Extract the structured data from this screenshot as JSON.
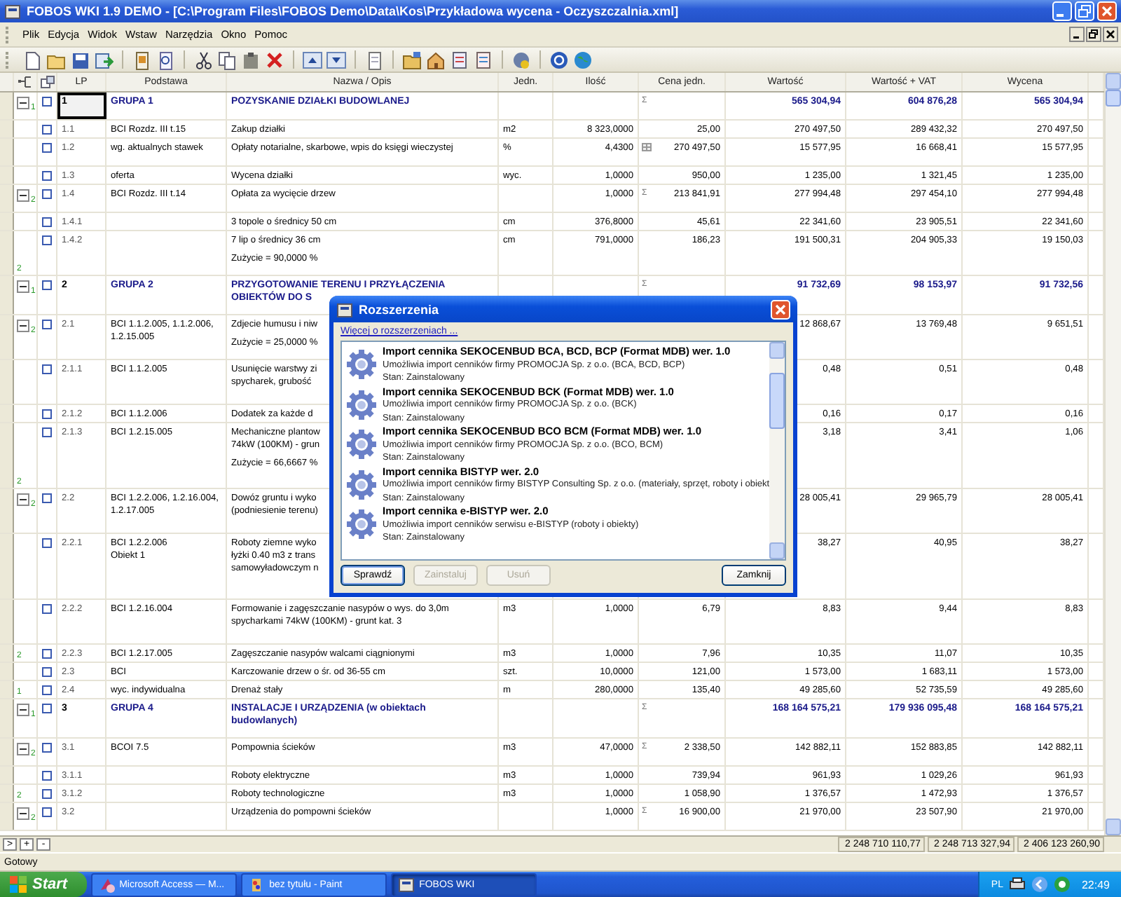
{
  "window": {
    "title": "FOBOS WKI  1.9 DEMO - [C:\\Program Files\\FOBOS Demo\\Data\\Kos\\Przykładowa wycena - Oczyszczalnia.xml]"
  },
  "menu": [
    "Plik",
    "Edycja",
    "Widok",
    "Wstaw",
    "Narzędzia",
    "Okno",
    "Pomoc"
  ],
  "table": {
    "columns": [
      "LP",
      "Podstawa",
      "Nazwa / Opis",
      "Jedn.",
      "Ilość",
      "Cena jedn.",
      "Wartość",
      "Wartość + VAT",
      "Wycena"
    ],
    "rows": [
      {
        "lp": "1",
        "podstawa": "GRUPA 1",
        "nazwa": "POZYSKANIE DZIAŁKI BUDOWLANEJ",
        "cena_mark": {
          "kind": "sigma",
          "text": "Σ"
        },
        "wartosc": "565 304,94",
        "wartosc_vat": "604 876,28",
        "wycena": "565 304,94",
        "group": true,
        "selected": true,
        "tree": {
          "kind": "expand",
          "label": "1"
        }
      },
      {
        "lp": "1.1",
        "podstawa": "BCI Rozdz. III t.15",
        "nazwa": "Zakup działki",
        "jedn": "m2",
        "ilosc": "8 323,0000",
        "cena": "25,00",
        "wartosc": "270 497,50",
        "wartosc_vat": "289 432,32",
        "wycena": "270 497,50",
        "group": false,
        "selected": false
      },
      {
        "lp": "1.2",
        "podstawa": "wg. aktualnych stawek",
        "nazwa": "Opłaty notarialne, skarbowe, wpis do księgi wieczystej",
        "jedn": "%",
        "ilosc": "4,4300",
        "cena_mark": {
          "kind": "table"
        },
        "cena": "270 497,50",
        "wartosc": "15 577,95",
        "wartosc_vat": "16 668,41",
        "wycena": "15 577,95",
        "group": false,
        "selected": false
      },
      {
        "lp": "1.3",
        "podstawa": "oferta",
        "nazwa": "Wycena działki",
        "jedn": "wyc.",
        "ilosc": "1,0000",
        "cena": "950,00",
        "wartosc": "1 235,00",
        "wartosc_vat": "1 321,45",
        "wycena": "1 235,00",
        "group": false,
        "selected": false
      },
      {
        "lp": "1.4",
        "podstawa": "BCI Rozdz. III t.14",
        "nazwa": "Opłata za wycięcie drzew",
        "ilosc": "1,0000",
        "cena_mark": {
          "kind": "sigma",
          "text": "Σ"
        },
        "cena": "213 841,91",
        "wartosc": "277 994,48",
        "wartosc_vat": "297 454,10",
        "wycena": "277 994,48",
        "group": false,
        "selected": false,
        "tree": {
          "kind": "expand",
          "label": "2"
        }
      },
      {
        "lp": "1.4.1",
        "nazwa": "3 topole o średnicy 50 cm",
        "jedn": "cm",
        "ilosc": "376,8000",
        "cena": "45,61",
        "wartosc": "22 341,60",
        "wartosc_vat": "23 905,51",
        "wycena": "22 341,60",
        "group": false,
        "selected": false
      },
      {
        "lp": "1.4.2",
        "nazwa": "7 lip o średnicy 36 cm",
        "note": "Zużycie = 90,0000 %",
        "jedn": "cm",
        "ilosc": "791,0000",
        "cena": "186,23",
        "wartosc": "191 500,31",
        "wartosc_vat": "204 905,33",
        "wycena": "19 150,03",
        "group": false,
        "selected": false,
        "tree": {
          "kind": "end",
          "label": "2"
        }
      },
      {
        "lp": "2",
        "podstawa": "GRUPA 2",
        "nazwa": "PRZYGOTOWANIE TERENU I PRZYŁĄCZENIA\nOBIEKTÓW DO S",
        "cena_mark": {
          "kind": "sigma",
          "text": "Σ"
        },
        "wartosc": "91 732,69",
        "wartosc_vat": "98 153,97",
        "wycena": "91 732,56",
        "group": true,
        "selected": false,
        "tree": {
          "kind": "expand",
          "label": "1"
        }
      },
      {
        "lp": "2.1",
        "podstawa": "BCI 1.1.2.005,  1.1.2.006,\n1.2.15.005",
        "nazwa": "Zdjecie humusu i niw",
        "note": "Zużycie = 25,0000 %",
        "wartosc": "12 868,67",
        "wartosc_vat": "13 769,48",
        "wycena": "9 651,51",
        "group": false,
        "selected": false,
        "tree": {
          "kind": "expand",
          "label": "2"
        }
      },
      {
        "lp": "2.1.1",
        "podstawa": "BCI 1.1.2.005",
        "nazwa": "Usunięcie warstwy zi\nspycharek, grubość",
        "wartosc": "0,48",
        "wartosc_vat": "0,51",
        "wycena": "0,48",
        "group": false,
        "selected": false
      },
      {
        "lp": "2.1.2",
        "podstawa": "BCI 1.1.2.006",
        "nazwa": "Dodatek za każde d",
        "wartosc": "0,16",
        "wartosc_vat": "0,17",
        "wycena": "0,16",
        "group": false,
        "selected": false
      },
      {
        "lp": "2.1.3",
        "podstawa": "BCI 1.2.15.005",
        "nazwa": "Mechaniczne plantow\n74kW (100KM) - grun",
        "note": "Zużycie = 66,6667 %",
        "wartosc": "3,18",
        "wartosc_vat": "3,41",
        "wycena": "1,06",
        "group": false,
        "selected": false,
        "tree": {
          "kind": "end",
          "label": "2"
        }
      },
      {
        "lp": "2.2",
        "podstawa": "BCI 1.2.2.006,  1.2.16.004,\n1.2.17.005",
        "nazwa": "Dowóz gruntu i wyko\n(podniesienie terenu)",
        "wartosc": "28 005,41",
        "wartosc_vat": "29 965,79",
        "wycena": "28 005,41",
        "group": false,
        "selected": false,
        "tree": {
          "kind": "expand",
          "label": "2"
        }
      },
      {
        "lp": "2.2.1",
        "podstawa": "BCI 1.2.2.006\nObiekt 1",
        "nazwa": "Roboty ziemne wyko\nłyżki 0.40 m3  z trans\nsamowyładowczym n",
        "wartosc": "38,27",
        "wartosc_vat": "40,95",
        "wycena": "38,27",
        "group": false,
        "selected": false
      },
      {
        "lp": "2.2.2",
        "podstawa": "BCI 1.2.16.004",
        "nazwa": "Formowanie i zagęszczanie nasypów o wys. do 3,0m\nspycharkami 74kW (100KM) - grunt kat. 3",
        "jedn": "m3",
        "ilosc": "1,0000",
        "cena": "6,79",
        "wartosc": "8,83",
        "wartosc_vat": "9,44",
        "wycena": "8,83",
        "group": false,
        "selected": false
      },
      {
        "lp": "2.2.3",
        "podstawa": "BCI 1.2.17.005",
        "nazwa": "Zagęszczanie nasypów walcami ciągnionymi",
        "jedn": "m3",
        "ilosc": "1,0000",
        "cena": "7,96",
        "wartosc": "10,35",
        "wartosc_vat": "11,07",
        "wycena": "10,35",
        "group": false,
        "selected": false,
        "tree": {
          "kind": "end",
          "label": "2"
        }
      },
      {
        "lp": "2.3",
        "podstawa": "BCI",
        "nazwa": "Karczowanie drzew o śr. od 36-55 cm",
        "jedn": "szt.",
        "ilosc": "10,0000",
        "cena": "121,00",
        "wartosc": "1 573,00",
        "wartosc_vat": "1 683,11",
        "wycena": "1 573,00",
        "group": false,
        "selected": false
      },
      {
        "lp": "2.4",
        "podstawa": "wyc. indywidualna",
        "nazwa": "Drenaż stały",
        "jedn": "m",
        "ilosc": "280,0000",
        "cena": "135,40",
        "wartosc": "49 285,60",
        "wartosc_vat": "52 735,59",
        "wycena": "49 285,60",
        "group": false,
        "selected": false,
        "tree": {
          "kind": "end",
          "label": "1"
        }
      },
      {
        "lp": "3",
        "podstawa": "GRUPA 4",
        "nazwa": "INSTALACJE I URZĄDZENIA (w obiektach\nbudowlanych)",
        "cena_mark": {
          "kind": "sigma",
          "text": "Σ"
        },
        "wartosc": "168 164 575,21",
        "wartosc_vat": "179 936 095,48",
        "wycena": "168 164 575,21",
        "group": true,
        "selected": false,
        "tree": {
          "kind": "expand",
          "label": "1"
        }
      },
      {
        "lp": "3.1",
        "podstawa": "BCOI 7.5",
        "nazwa": "Pompownia ścieków",
        "jedn": "m3",
        "ilosc": "47,0000",
        "cena_mark": {
          "kind": "sigma",
          "text": "Σ"
        },
        "cena": "2 338,50",
        "wartosc": "142 882,11",
        "wartosc_vat": "152 883,85",
        "wycena": "142 882,11",
        "group": false,
        "selected": false,
        "tree": {
          "kind": "expand",
          "label": "2"
        }
      },
      {
        "lp": "3.1.1",
        "nazwa": "Roboty elektryczne",
        "jedn": "m3",
        "ilosc": "1,0000",
        "cena": "739,94",
        "wartosc": "961,93",
        "wartosc_vat": "1 029,26",
        "wycena": "961,93",
        "group": false,
        "selected": false
      },
      {
        "lp": "3.1.2",
        "nazwa": "Roboty technologiczne",
        "jedn": "m3",
        "ilosc": "1,0000",
        "cena": "1 058,90",
        "wartosc": "1 376,57",
        "wartosc_vat": "1 472,93",
        "wycena": "1 376,57",
        "group": false,
        "selected": false,
        "tree": {
          "kind": "end",
          "label": "2"
        }
      },
      {
        "lp": "3.2",
        "nazwa": "Urządzenia do pompowni ścieków",
        "ilosc": "1,0000",
        "cena_mark": {
          "kind": "sigma",
          "text": "Σ"
        },
        "cena": "16 900,00",
        "wartosc": "21 970,00",
        "wartosc_vat": "23 507,90",
        "wycena": "21 970,00",
        "group": false,
        "selected": false,
        "tree": {
          "kind": "expand",
          "label": "2"
        }
      }
    ]
  },
  "footer": {
    "nav_buttons": [
      ">",
      "+",
      "-"
    ],
    "totals": [
      "2 248 710 110,77",
      "2 248 713 327,94",
      "2 406 123 260,90"
    ]
  },
  "status_bar": "Gotowy",
  "dialog": {
    "title": "Rozszerzenia",
    "link": "Więcej o rozszerzeniach ...",
    "extensions": [
      {
        "name": "Import cennika SEKOCENBUD BCA, BCD, BCP (Format MDB) wer. 1.0",
        "description": "Umożliwia import cenników firmy PROMOCJA Sp. z o.o. (BCA, BCD, BCP)",
        "state": "Stan: Zainstalowany"
      },
      {
        "name": "Import cennika SEKOCENBUD BCK (Format MDB) wer. 1.0",
        "description": "Umożliwia import cenników firmy PROMOCJA Sp. z o.o. (BCK)",
        "state": "Stan: Zainstalowany"
      },
      {
        "name": "Import cennika SEKOCENBUD BCO BCM (Format MDB) wer. 1.0",
        "description": "Umożliwia import cenników firmy PROMOCJA Sp. z o.o. (BCO, BCM)",
        "state": "Stan: Zainstalowany"
      },
      {
        "name": "Import cennika BISTYP wer. 2.0",
        "description": "Umożliwia import cenników firmy BISTYP Consulting Sp. z o.o. (materiały, sprzęt, roboty i obiekt",
        "state": "Stan: Zainstalowany"
      },
      {
        "name": "Import cennika e-BISTYP wer. 2.0",
        "description": "Umożliwia import cenników serwisu e-BISTYP (roboty i obiekty)",
        "state": "Stan: Zainstalowany"
      }
    ],
    "buttons": [
      {
        "label": "Sprawdź",
        "disabled": false,
        "focused": true
      },
      {
        "label": "Zainstaluj",
        "disabled": true,
        "focused": false
      },
      {
        "label": "Usuń",
        "disabled": true,
        "focused": false
      },
      {
        "label": "Zamknij",
        "disabled": false,
        "focused": false
      }
    ]
  },
  "taskbar": {
    "start": "Start",
    "tasks": [
      {
        "label": "Microsoft Access — M...",
        "kind": "access",
        "selected": false
      },
      {
        "label": "bez tytułu - Paint",
        "kind": "paint",
        "selected": false
      },
      {
        "label": "FOBOS WKI",
        "kind": "app",
        "selected": true
      }
    ],
    "language": "PL",
    "clock": "22:49"
  }
}
